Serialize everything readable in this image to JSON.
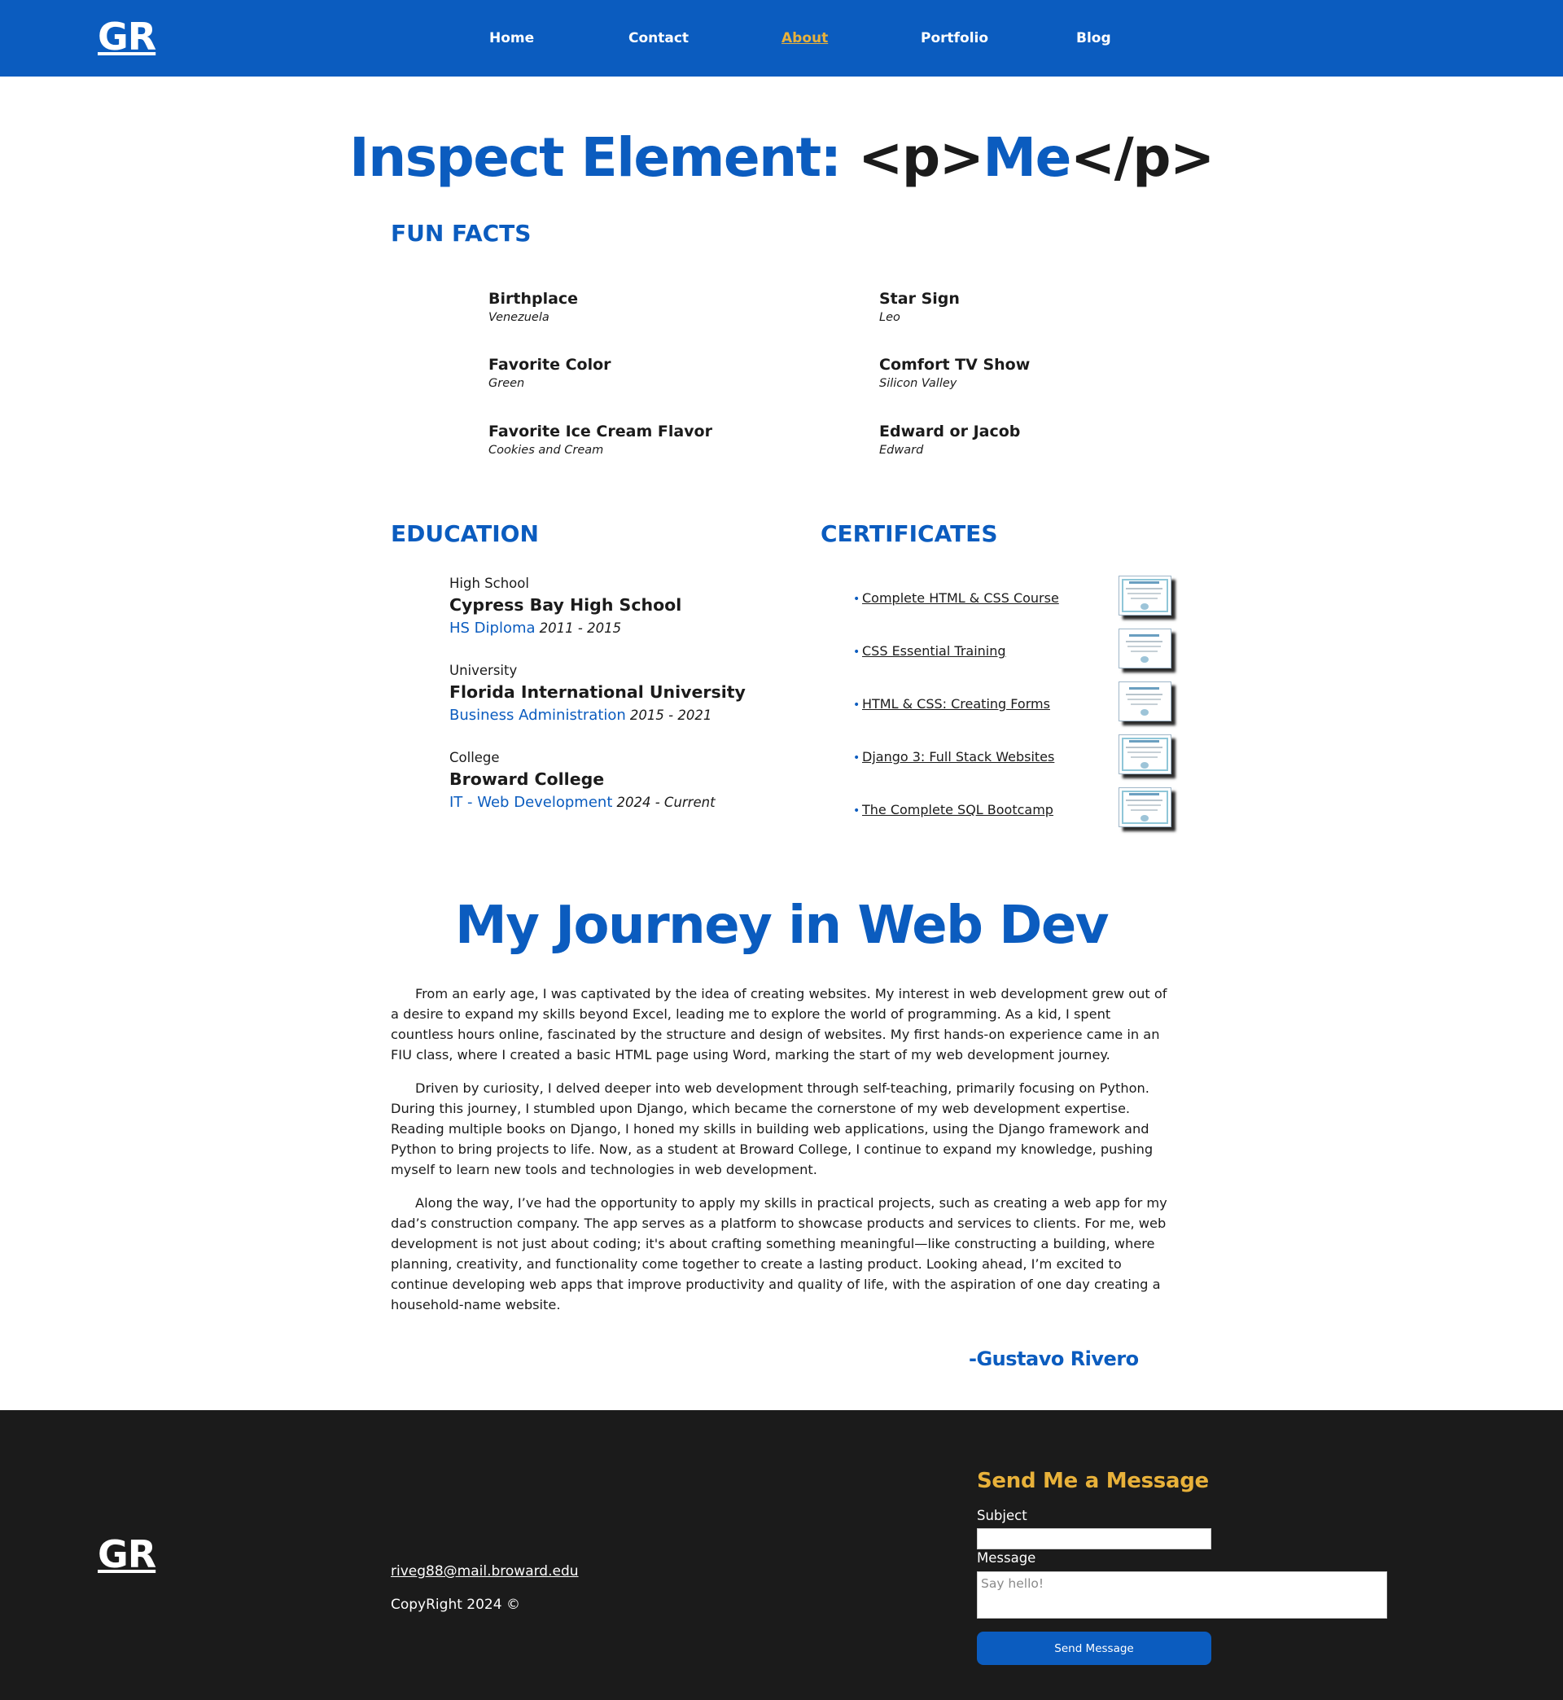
{
  "nav": {
    "logo": "GR",
    "links": [
      "Home",
      "Contact",
      "About",
      "Portfolio",
      "Blog"
    ],
    "active": "About"
  },
  "hero": {
    "part1": "Inspect Element: ",
    "tag_open": "<p>",
    "word": "Me",
    "tag_close": "</p>"
  },
  "fun_facts": {
    "heading": "FUN FACTS",
    "items": [
      {
        "label": "Birthplace",
        "value": "Venezuela"
      },
      {
        "label": "Star Sign",
        "value": "Leo"
      },
      {
        "label": "Favorite Color",
        "value": "Green"
      },
      {
        "label": "Comfort TV Show",
        "value": "Silicon Valley"
      },
      {
        "label": "Favorite Ice Cream Flavor",
        "value": "Cookies and Cream"
      },
      {
        "label": "Edward or Jacob",
        "value": "Edward"
      }
    ]
  },
  "education": {
    "heading": "EDUCATION",
    "items": [
      {
        "level": "High School",
        "school": "Cypress Bay High School",
        "degree": "HS Diploma",
        "years": "2011 - 2015"
      },
      {
        "level": "University",
        "school": "Florida International University",
        "degree": "Business Administration",
        "years": "2015 - 2021"
      },
      {
        "level": "College",
        "school": "Broward College",
        "degree": "IT - Web Development",
        "years": "2024 - Current"
      }
    ]
  },
  "certificates": {
    "heading": "CERTIFICATES",
    "items": [
      "Complete HTML & CSS Course",
      "CSS Essential Training",
      "HTML & CSS: Creating Forms",
      "Django 3: Full Stack Websites",
      "The Complete SQL Bootcamp"
    ]
  },
  "journey": {
    "title": "My Journey in Web Dev",
    "paragraphs": [
      "From an early age, I was captivated by the idea of creating websites. My interest in web development grew out of a desire to expand my skills beyond Excel, leading me to explore the world of programming. As a kid, I spent countless hours online, fascinated by the structure and design of websites. My first hands-on experience came in an FIU class, where I created a basic HTML page using Word, marking the start of my web development journey.",
      "Driven by curiosity, I delved deeper into web development through self-teaching, primarily focusing on Python. During this journey, I stumbled upon Django, which became the cornerstone of my web development expertise. Reading multiple books on Django, I honed my skills in building web applications, using the Django framework and Python to bring projects to life. Now, as a student at Broward College, I continue to expand my knowledge, pushing myself to learn new tools and technologies in web development.",
      "Along the way, I’ve had the opportunity to apply my skills in practical projects, such as creating a web app for my dad’s construction company. The app serves as a platform to showcase products and services to clients. For me, web development is not just about coding; it's about crafting something meaningful—like constructing a building, where planning, creativity, and functionality come together to create a lasting product. Looking ahead, I’m excited to continue developing web apps that improve productivity and quality of life, with the aspiration of one day creating a household-name website."
    ],
    "signature": "-Gustavo Rivero"
  },
  "footer": {
    "logo": "GR",
    "email": "riveg88@mail.broward.edu",
    "copyright": "CopyRight 2024 ©",
    "form": {
      "title": "Send Me a Message",
      "subject_label": "Subject",
      "subject_value": "",
      "message_label": "Message",
      "message_placeholder": "Say hello!",
      "button": "Send Message"
    }
  },
  "colors": {
    "brand_blue": "#0b5cbf",
    "accent_gold": "#e8b13a",
    "footer_bg": "#1b1b1b",
    "text": "#1b1b1b"
  }
}
